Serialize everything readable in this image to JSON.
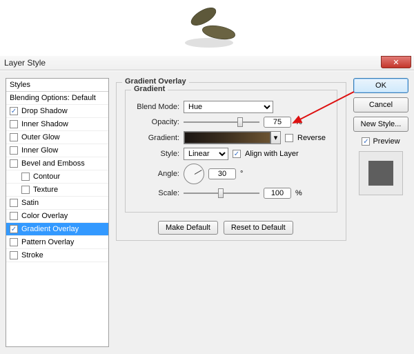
{
  "window": {
    "title": "Layer Style",
    "close_icon": "✕"
  },
  "sidebar": {
    "header": "Styles",
    "blending_default": "Blending Options: Default",
    "items": [
      {
        "label": "Drop Shadow",
        "checked": true
      },
      {
        "label": "Inner Shadow",
        "checked": false
      },
      {
        "label": "Outer Glow",
        "checked": false
      },
      {
        "label": "Inner Glow",
        "checked": false
      },
      {
        "label": "Bevel and Emboss",
        "checked": false
      },
      {
        "label": "Contour",
        "checked": false,
        "indent": true
      },
      {
        "label": "Texture",
        "checked": false,
        "indent": true
      },
      {
        "label": "Satin",
        "checked": false
      },
      {
        "label": "Color Overlay",
        "checked": false
      },
      {
        "label": "Gradient Overlay",
        "checked": true,
        "selected": true
      },
      {
        "label": "Pattern Overlay",
        "checked": false
      },
      {
        "label": "Stroke",
        "checked": false
      }
    ]
  },
  "panel": {
    "title": "Gradient Overlay",
    "group": "Gradient",
    "blend_mode_label": "Blend Mode:",
    "blend_mode_value": "Hue",
    "opacity_label": "Opacity:",
    "opacity_value": "75",
    "opacity_unit": "%",
    "gradient_label": "Gradient:",
    "reverse_label": "Reverse",
    "reverse_checked": false,
    "style_label": "Style:",
    "style_value": "Linear",
    "align_label": "Align with Layer",
    "align_checked": true,
    "angle_label": "Angle:",
    "angle_value": "30",
    "angle_unit": "°",
    "scale_label": "Scale:",
    "scale_value": "100",
    "scale_unit": "%",
    "make_default": "Make Default",
    "reset_default": "Reset to Default"
  },
  "buttons": {
    "ok": "OK",
    "cancel": "Cancel",
    "new_style": "New Style...",
    "preview": "Preview",
    "preview_checked": true
  },
  "accent": "#3399ff"
}
